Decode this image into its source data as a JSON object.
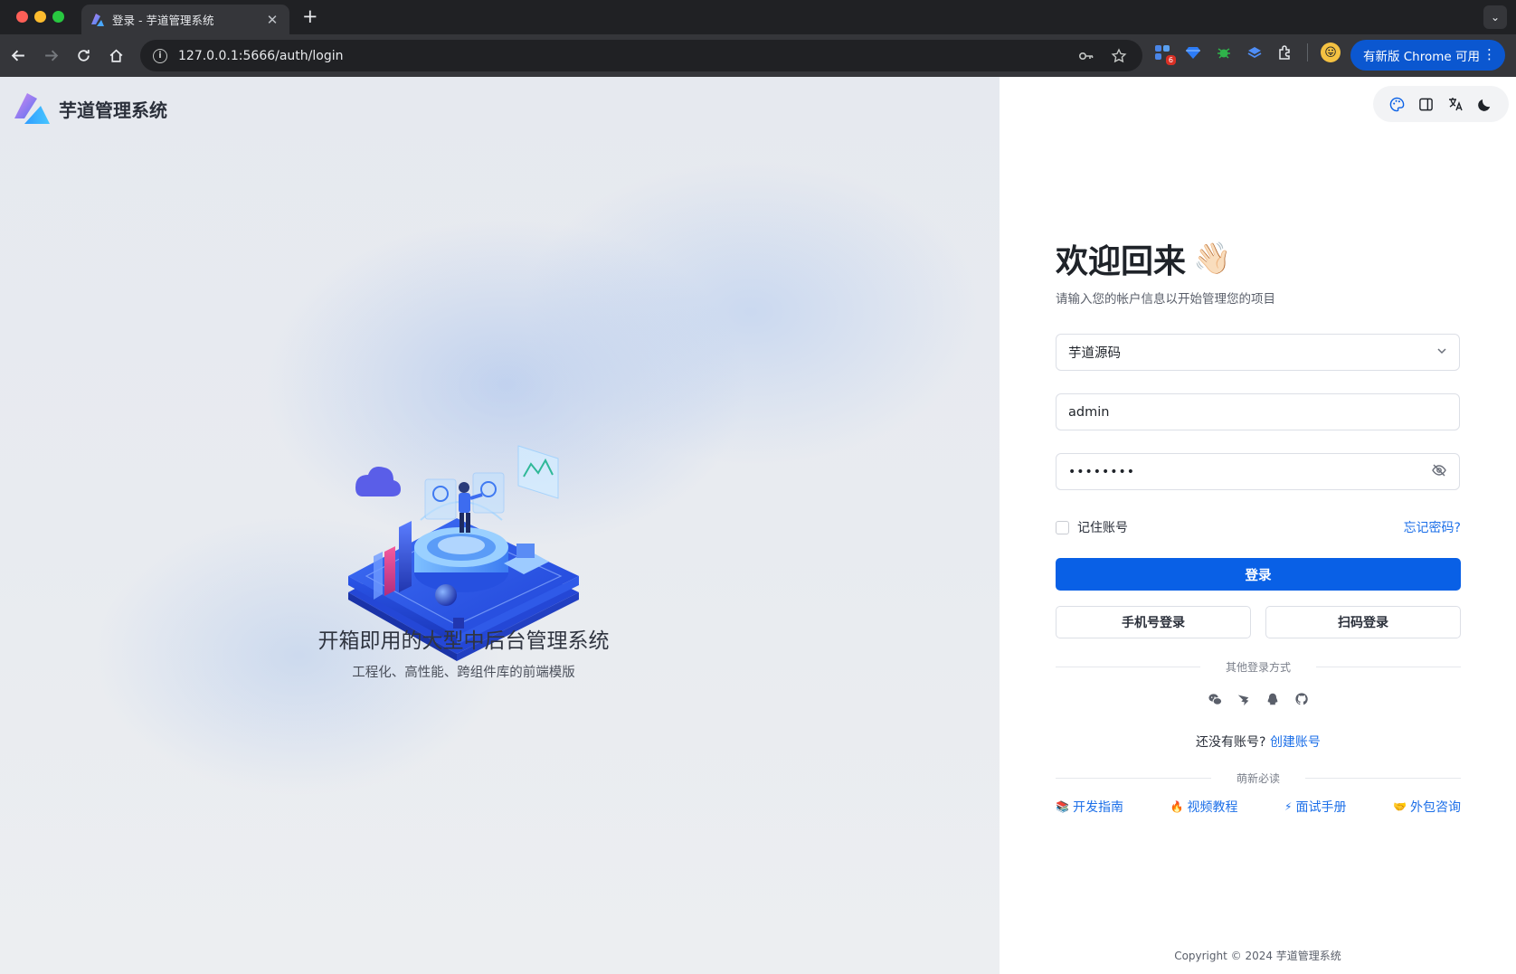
{
  "browser": {
    "tab_title": "登录 - 芋道管理系统",
    "url": "127.0.0.1:5666/auth/login",
    "extension_badge": "6",
    "update_label": "有新版 Chrome 可用"
  },
  "app": {
    "name": "芋道管理系统",
    "hero_title": "开箱即用的大型中后台管理系统",
    "hero_subtitle": "工程化、高性能、跨组件库的前端模版"
  },
  "login": {
    "welcome": "欢迎回来",
    "welcome_emoji": "👋🏻",
    "subtitle": "请输入您的帐户信息以开始管理您的项目",
    "tenant_selected": "芋道源码",
    "username_value": "admin",
    "password_mask": "••••••••",
    "remember_label": "记住账号",
    "forgot_label": "忘记密码?",
    "login_button": "登录",
    "phone_login": "手机号登录",
    "qr_login": "扫码登录",
    "other_methods": "其他登录方式",
    "no_account": "还没有账号?",
    "create_account": "创建账号",
    "must_read": "萌新必读",
    "links": [
      {
        "emoji": "📚",
        "label": "开发指南"
      },
      {
        "emoji": "🔥",
        "label": "视频教程"
      },
      {
        "emoji": "⚡",
        "label": "面试手册"
      },
      {
        "emoji": "🤝",
        "label": "外包咨询"
      }
    ],
    "copyright": "Copyright © 2024 芋道管理系统"
  },
  "colors": {
    "primary": "#0960e6",
    "link": "#1c6fe8"
  },
  "icons": {
    "social": [
      "wechat-icon",
      "dingtalk-icon",
      "qq-icon",
      "github-icon"
    ],
    "toolbar": [
      "palette-icon",
      "layout-icon",
      "translate-icon",
      "moon-icon"
    ]
  }
}
